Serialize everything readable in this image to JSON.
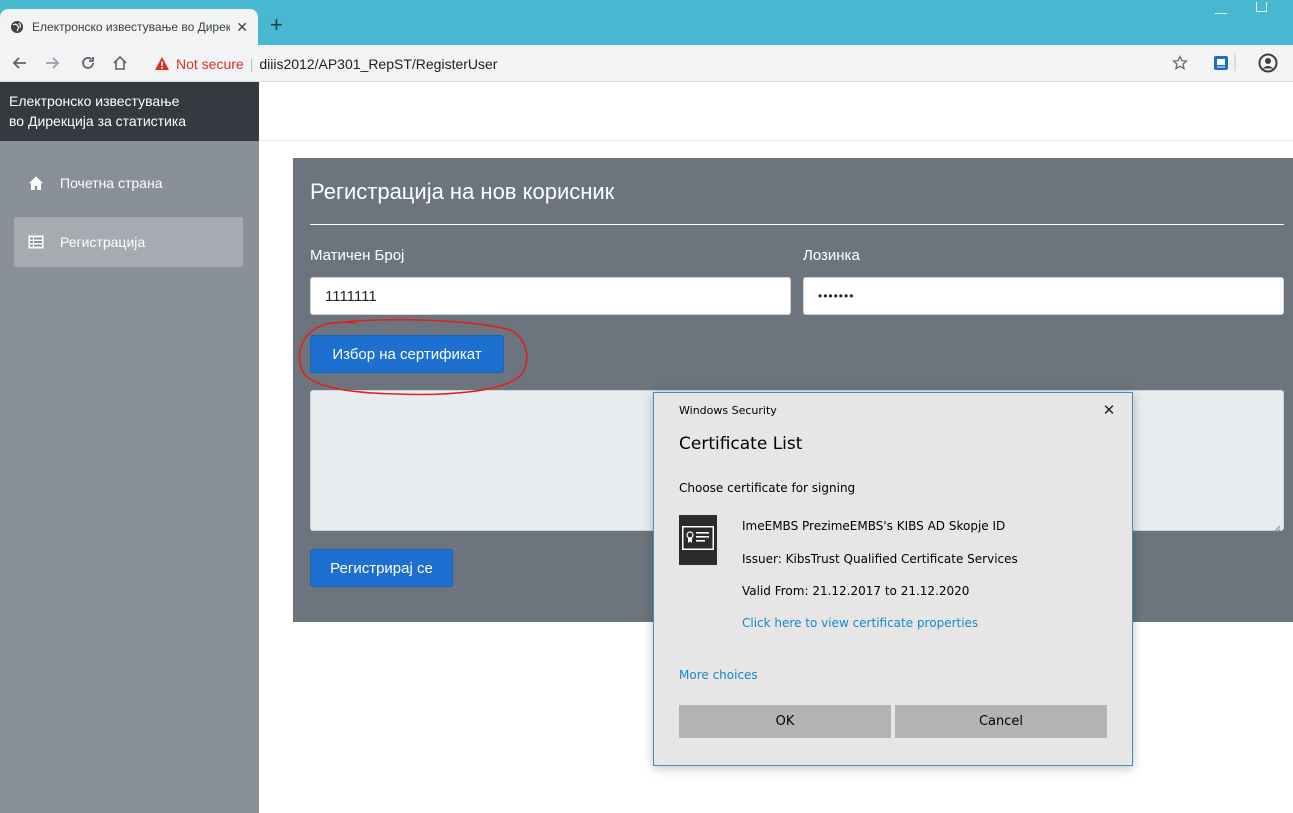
{
  "browser": {
    "tab_title": "Електронско известување во Дирекција за статистика",
    "new_tab": "+",
    "tab_close": "✕",
    "not_secure": "Not secure",
    "separator": "|",
    "url": "diiis2012/AP301_RepST/RegisterUser"
  },
  "sidebar": {
    "brand_line1": "Електронско известување",
    "brand_line2": "во Дирекција за статистика",
    "items": [
      {
        "label": "Почетна страна",
        "icon": "home-icon",
        "active": false
      },
      {
        "label": "Регистрација",
        "icon": "list-icon",
        "active": true
      }
    ]
  },
  "form": {
    "title": "Регистрација на нов корисник",
    "id_label": "Матичен Број",
    "id_value": "1111111",
    "password_label": "Лозинка",
    "password_value": "•••••••",
    "choose_cert_button": "Избор на сертификат",
    "register_button": "Регистрирај се"
  },
  "dialog": {
    "caption": "Windows Security",
    "close": "✕",
    "title": "Certificate List",
    "prompt": "Choose certificate for signing",
    "cert_name": "ImeEMBS PrezimeEMBS's KIBS AD Skopje ID",
    "cert_issuer": "Issuer: KibsTrust Qualified Certificate Services",
    "cert_valid": "Valid From: 21.12.2017 to 21.12.2020",
    "view_properties_link": "Click here to view certificate properties",
    "more_choices_link": "More choices",
    "ok_button": "OK",
    "cancel_button": "Cancel"
  },
  "colors": {
    "tabstrip": "#48b8d0",
    "panel": "#6c757d",
    "button_blue": "#1d6fd0",
    "annotation_red": "#e02020",
    "link_blue": "#1a87c8"
  }
}
